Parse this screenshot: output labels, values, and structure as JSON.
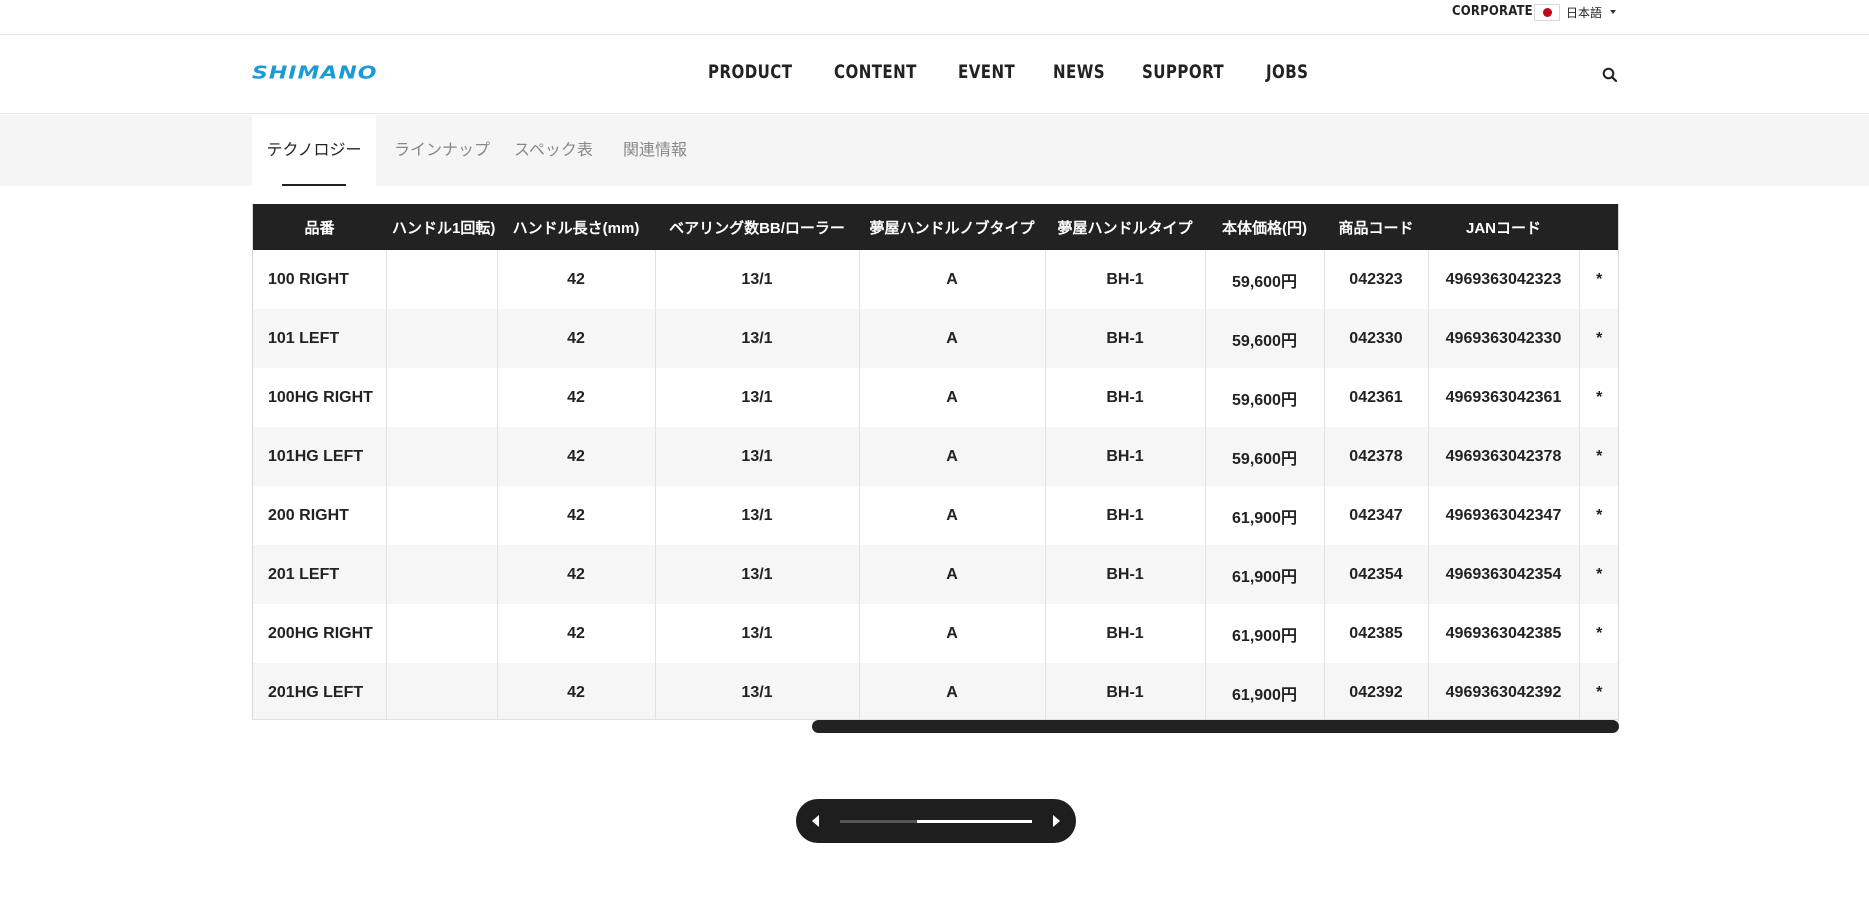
{
  "topbar": {
    "corporate": "CORPORATE",
    "language": "日本語"
  },
  "header": {
    "logo": "SHIMANO",
    "nav": [
      "PRODUCT",
      "CONTENT",
      "EVENT",
      "NEWS",
      "SUPPORT",
      "JOBS"
    ]
  },
  "tabs": [
    {
      "label": "テクノロジー",
      "active": true
    },
    {
      "label": "ラインナップ",
      "active": false
    },
    {
      "label": "スペック表",
      "active": false
    },
    {
      "label": "関連情報",
      "active": false
    }
  ],
  "table": {
    "headers": [
      "品番",
      "ハンドル1回転)",
      "ハンドル長さ(mm)",
      "ベアリング数BB/ローラー",
      "夢屋ハンドルノブタイプ",
      "夢屋ハンドルタイプ",
      "本体価格(円)",
      "商品コード",
      "JANコード",
      ""
    ],
    "rows": [
      [
        "100 RIGHT",
        "",
        "42",
        "13/1",
        "A",
        "BH-1",
        "59,600円",
        "042323",
        "4969363042323",
        "*"
      ],
      [
        "101 LEFT",
        "",
        "42",
        "13/1",
        "A",
        "BH-1",
        "59,600円",
        "042330",
        "4969363042330",
        "*"
      ],
      [
        "100HG RIGHT",
        "",
        "42",
        "13/1",
        "A",
        "BH-1",
        "59,600円",
        "042361",
        "4969363042361",
        "*"
      ],
      [
        "101HG LEFT",
        "",
        "42",
        "13/1",
        "A",
        "BH-1",
        "59,600円",
        "042378",
        "4969363042378",
        "*"
      ],
      [
        "200 RIGHT",
        "",
        "42",
        "13/1",
        "A",
        "BH-1",
        "61,900円",
        "042347",
        "4969363042347",
        "*"
      ],
      [
        "201 LEFT",
        "",
        "42",
        "13/1",
        "A",
        "BH-1",
        "61,900円",
        "042354",
        "4969363042354",
        "*"
      ],
      [
        "200HG RIGHT",
        "",
        "42",
        "13/1",
        "A",
        "BH-1",
        "61,900円",
        "042385",
        "4969363042385",
        "*"
      ],
      [
        "201HG LEFT",
        "",
        "42",
        "13/1",
        "A",
        "BH-1",
        "61,900円",
        "042392",
        "4969363042392",
        "*"
      ]
    ]
  },
  "scrollbar": {
    "position_fraction": 0.41,
    "visible_fraction": 0.59
  },
  "pager": {
    "progress_fraction": 0.6
  },
  "icons": {
    "search": "search-icon",
    "prev": "chevron-left-icon",
    "next": "chevron-right-icon"
  },
  "colors": {
    "brand": "#1a9ad6",
    "header_bg": "#222222",
    "accent_flag": "#c4001a"
  }
}
